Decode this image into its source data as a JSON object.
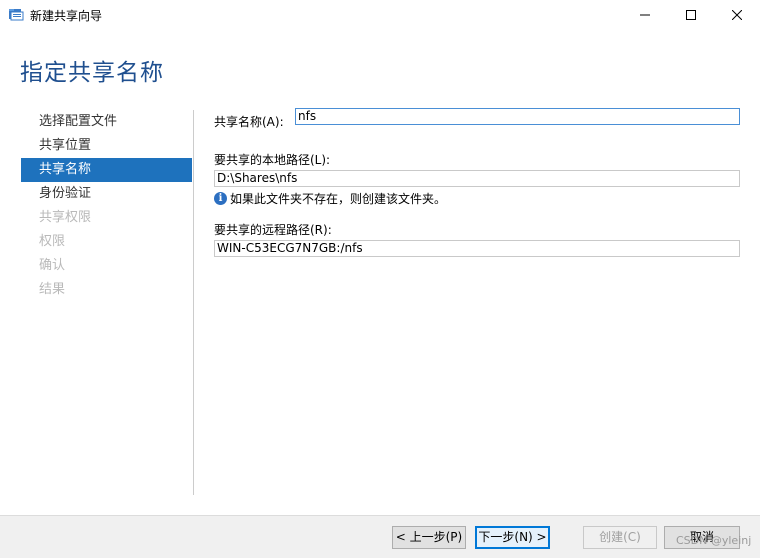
{
  "window": {
    "title": "新建共享向导",
    "minimize_label": "Minimize",
    "maximize_label": "Maximize",
    "close_label": "Close"
  },
  "page": {
    "title": "指定共享名称"
  },
  "nav": {
    "items": [
      {
        "label": "选择配置文件",
        "state": "normal"
      },
      {
        "label": "共享位置",
        "state": "normal"
      },
      {
        "label": "共享名称",
        "state": "active"
      },
      {
        "label": "身份验证",
        "state": "normal"
      },
      {
        "label": "共享权限",
        "state": "disabled"
      },
      {
        "label": "权限",
        "state": "disabled"
      },
      {
        "label": "确认",
        "state": "disabled"
      },
      {
        "label": "结果",
        "state": "disabled"
      }
    ]
  },
  "form": {
    "share_name_label": "共享名称(A):",
    "share_name_value": "nfs",
    "local_path_label": "要共享的本地路径(L):",
    "local_path_value": "D:\\Shares\\nfs",
    "info_text": "如果此文件夹不存在，则创建该文件夹。",
    "remote_path_label": "要共享的远程路径(R):",
    "remote_path_value": "WIN-C53ECG7N7GB:/nfs"
  },
  "footer": {
    "prev_label": "< 上一步(P)",
    "next_label": "下一步(N) >",
    "create_label": "创建(C)",
    "cancel_label": "取消"
  },
  "watermark": "CSDN @yleinj",
  "colors": {
    "accent": "#1e72bd",
    "title": "#1f4f8f"
  }
}
